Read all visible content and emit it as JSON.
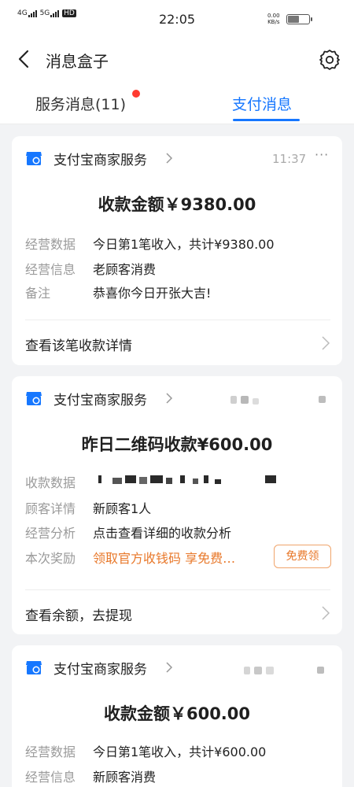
{
  "status_bar": {
    "signal1": "4G",
    "signal2": "5G",
    "hd": "HD",
    "time": "22:05",
    "net_speed": "0.00",
    "net_unit": "KB/s"
  },
  "header": {
    "title": "消息盒子"
  },
  "tabs": {
    "service": "服务消息(11)",
    "pay": "支付消息"
  },
  "colors": {
    "accent": "#1677ff",
    "orange": "#e8782a",
    "badge": "#ff3b30"
  },
  "cards": [
    {
      "shop": "支付宝商家服务",
      "time": "11:37",
      "amount": "收款金额￥9380.00",
      "rows": [
        {
          "label": "经营数据",
          "value": "今日第1笔收入，共计¥9380.00"
        },
        {
          "label": "经营信息",
          "value": "老顾客消费"
        },
        {
          "label": "备注",
          "value": "恭喜你今日开张大吉!"
        }
      ],
      "action": "查看该笔收款详情"
    },
    {
      "shop": "支付宝商家服务",
      "amount": "昨日二维码收款¥600.00",
      "rows": [
        {
          "label": "收款数据",
          "value": ""
        },
        {
          "label": "顾客详情",
          "value": "新顾客1人"
        },
        {
          "label": "经营分析",
          "value": "点击查看详细的收款分析"
        },
        {
          "label": "本次奖励",
          "value": "领取官方收钱码 享免费…"
        }
      ],
      "reward_button": "免费领",
      "action": "查看余额，去提现"
    },
    {
      "shop": "支付宝商家服务",
      "amount": "收款金额￥600.00",
      "rows": [
        {
          "label": "经营数据",
          "value": "今日第1笔收入，共计¥600.00"
        },
        {
          "label": "经营信息",
          "value": "新顾客消费"
        }
      ]
    }
  ]
}
